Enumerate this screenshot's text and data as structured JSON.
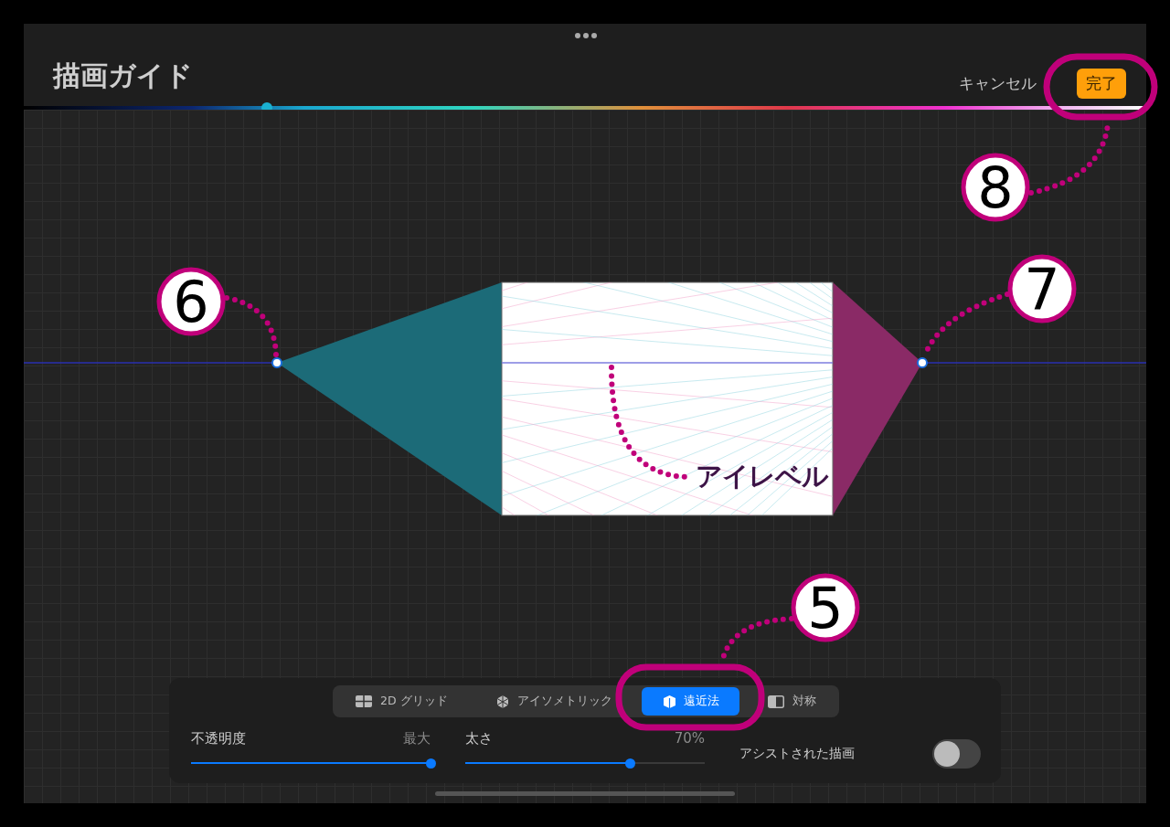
{
  "window": {
    "title": "描画ガイド"
  },
  "header": {
    "cancel": "キャンセル",
    "done": "完了"
  },
  "color_slider": {
    "level": 0.217
  },
  "guide_types": [
    {
      "kind": "grid",
      "label": "2D グリッド",
      "selected": false
    },
    {
      "kind": "isometric",
      "label": "アイソメトリック",
      "selected": false
    },
    {
      "kind": "perspective",
      "label": "遠近法",
      "selected": true
    },
    {
      "kind": "symmetry",
      "label": "対称",
      "selected": false
    }
  ],
  "settings": {
    "opacity": {
      "label": "不透明度",
      "reading": "最大",
      "level": 1
    },
    "thickness": {
      "label": "太さ",
      "reading": "70%",
      "level": 0.69
    },
    "assisted_drawing": {
      "label": "アシストされた描画",
      "on": false
    }
  },
  "annotations": {
    "callouts": [
      "5",
      "6",
      "7",
      "8"
    ],
    "eye_level_label": "アイレベル"
  }
}
